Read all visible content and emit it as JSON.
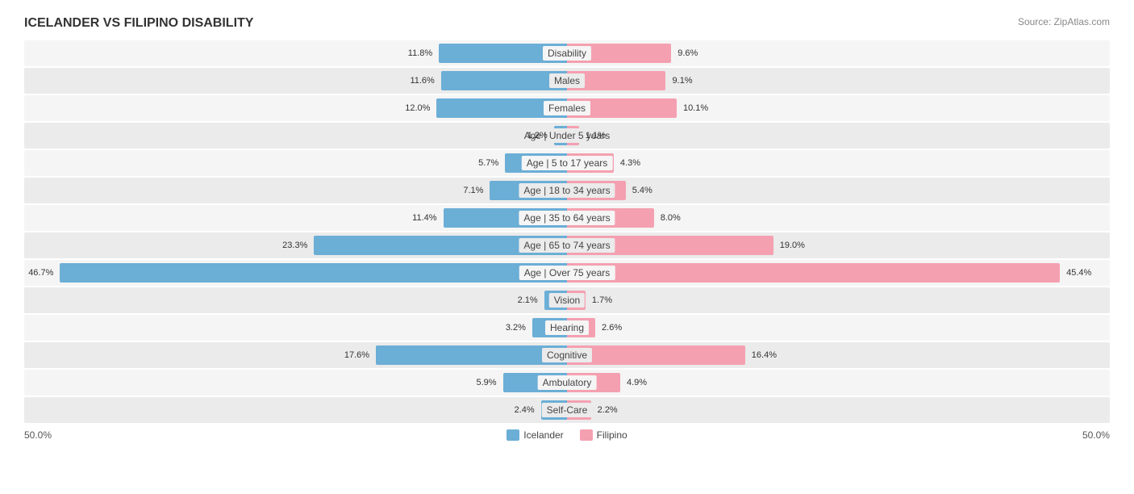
{
  "title": "ICELANDER VS FILIPINO DISABILITY",
  "source": "Source: ZipAtlas.com",
  "colors": {
    "icelander": "#6baed6",
    "filipino": "#f4a0b0",
    "row_odd": "#f5f5f5",
    "row_even": "#ebebeb"
  },
  "footer": {
    "left_scale": "50.0%",
    "right_scale": "50.0%"
  },
  "legend": {
    "icelander_label": "Icelander",
    "filipino_label": "Filipino"
  },
  "rows": [
    {
      "label": "Disability",
      "left_val": "11.8%",
      "left_pct": 23.6,
      "right_val": "9.6%",
      "right_pct": 19.2
    },
    {
      "label": "Males",
      "left_val": "11.6%",
      "left_pct": 23.2,
      "right_val": "9.1%",
      "right_pct": 18.2
    },
    {
      "label": "Females",
      "left_val": "12.0%",
      "left_pct": 24.0,
      "right_val": "10.1%",
      "right_pct": 20.2
    },
    {
      "label": "Age | Under 5 years",
      "left_val": "1.2%",
      "left_pct": 2.4,
      "right_val": "1.1%",
      "right_pct": 2.2
    },
    {
      "label": "Age | 5 to 17 years",
      "left_val": "5.7%",
      "left_pct": 11.4,
      "right_val": "4.3%",
      "right_pct": 8.6
    },
    {
      "label": "Age | 18 to 34 years",
      "left_val": "7.1%",
      "left_pct": 14.2,
      "right_val": "5.4%",
      "right_pct": 10.8
    },
    {
      "label": "Age | 35 to 64 years",
      "left_val": "11.4%",
      "left_pct": 22.8,
      "right_val": "8.0%",
      "right_pct": 16.0
    },
    {
      "label": "Age | 65 to 74 years",
      "left_val": "23.3%",
      "left_pct": 46.6,
      "right_val": "19.0%",
      "right_pct": 38.0
    },
    {
      "label": "Age | Over 75 years",
      "left_val": "46.7%",
      "left_pct": 93.4,
      "right_val": "45.4%",
      "right_pct": 90.8
    },
    {
      "label": "Vision",
      "left_val": "2.1%",
      "left_pct": 4.2,
      "right_val": "1.7%",
      "right_pct": 3.4
    },
    {
      "label": "Hearing",
      "left_val": "3.2%",
      "left_pct": 6.4,
      "right_val": "2.6%",
      "right_pct": 5.2
    },
    {
      "label": "Cognitive",
      "left_val": "17.6%",
      "left_pct": 35.2,
      "right_val": "16.4%",
      "right_pct": 32.8
    },
    {
      "label": "Ambulatory",
      "left_val": "5.9%",
      "left_pct": 11.8,
      "right_val": "4.9%",
      "right_pct": 9.8
    },
    {
      "label": "Self-Care",
      "left_val": "2.4%",
      "left_pct": 4.8,
      "right_val": "2.2%",
      "right_pct": 4.4
    }
  ]
}
